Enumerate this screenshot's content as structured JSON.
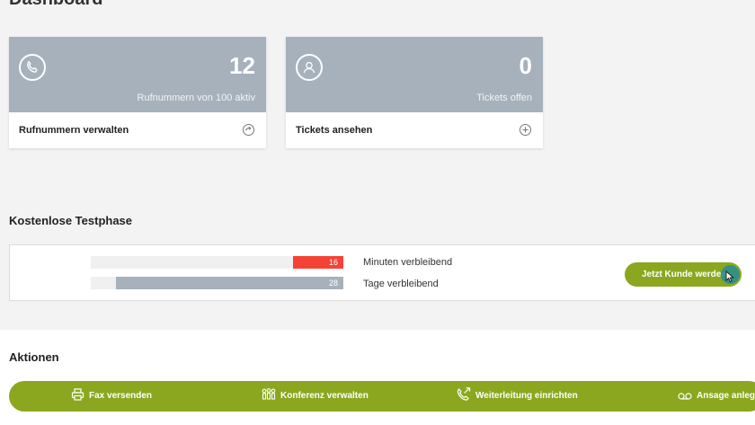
{
  "page": {
    "title": "Dashboard"
  },
  "cards": [
    {
      "icon": "phone-icon",
      "count": "12",
      "subtitle": "Rufnummern von 100 aktiv",
      "link_label": "Rufnummern verwalten",
      "action_icon": "arrow-circle-icon"
    },
    {
      "icon": "user-icon",
      "count": "0",
      "subtitle": "Tickets offen",
      "link_label": "Tickets ansehen",
      "action_icon": "plus-circle-icon"
    }
  ],
  "trial": {
    "title": "Kostenlose Testphase",
    "minutes": {
      "value": "16",
      "label": "Minuten verbleibend",
      "fraction": 0.2,
      "color": "#f44336"
    },
    "days": {
      "value": "28",
      "label": "Tage verbleibend",
      "fraction": 0.9,
      "color": "#a6b1bc"
    },
    "cta_label": "Jetzt Kunde werden"
  },
  "actions": {
    "title": "Aktionen",
    "items": [
      {
        "icon": "printer-icon",
        "label": "Fax versenden"
      },
      {
        "icon": "conference-icon",
        "label": "Konferenz verwalten"
      },
      {
        "icon": "phone-forward-icon",
        "label": "Weiterleitung einrichten"
      },
      {
        "icon": "voicemail-icon",
        "label": "Ansage anlegen"
      }
    ]
  },
  "colors": {
    "accent": "#8ba71f",
    "card_header": "#a6b1bc",
    "alert": "#f44336"
  }
}
